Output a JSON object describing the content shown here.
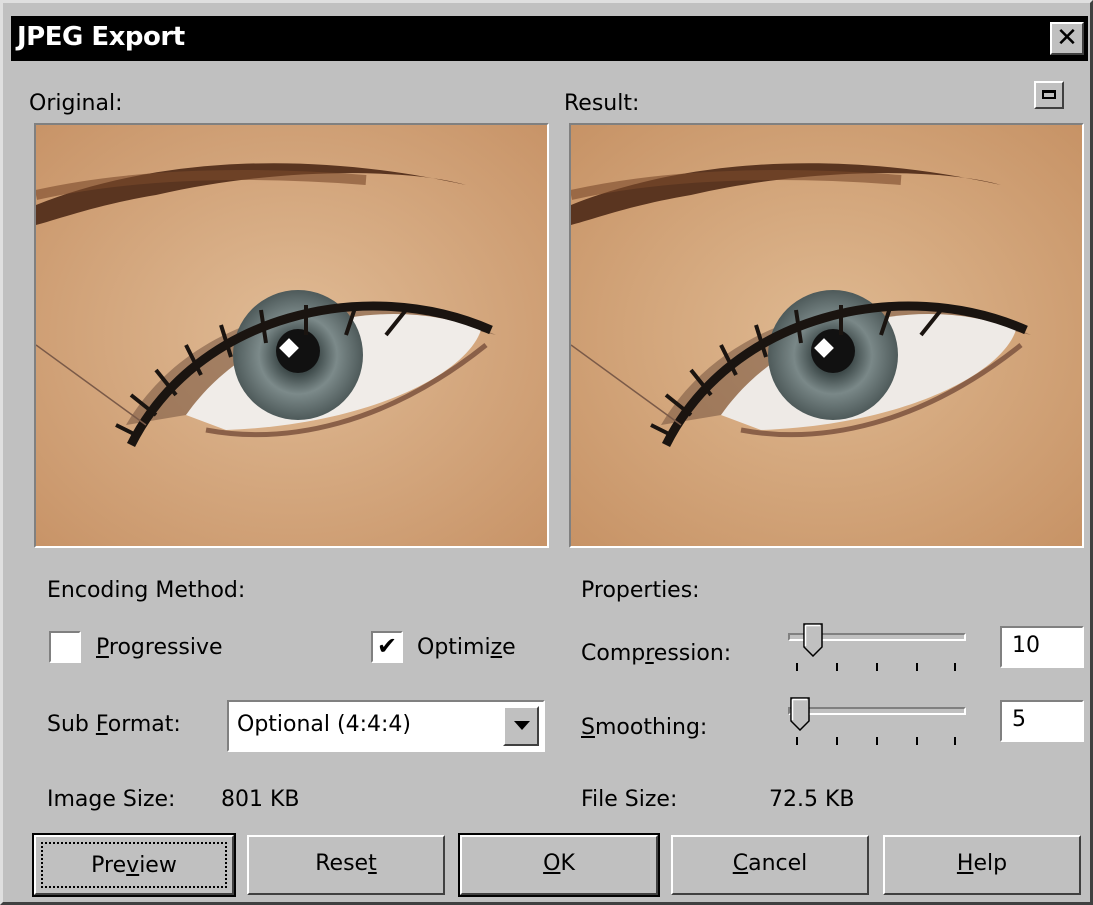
{
  "window": {
    "title": "JPEG Export",
    "close_glyph": "✕"
  },
  "panes": {
    "original_label": "Original:",
    "result_label": "Result:"
  },
  "encoding": {
    "heading": "Encoding Method:",
    "progressive_label_pre": "",
    "progressive_label_u": "P",
    "progressive_label_post": "rogressive",
    "progressive_checked": false,
    "optimize_label_pre": "Optimi",
    "optimize_label_u": "z",
    "optimize_label_post": "e",
    "optimize_checked": true,
    "check_glyph": "✔",
    "subformat_label_pre": "Sub ",
    "subformat_label_u": "F",
    "subformat_label_post": "ormat:",
    "subformat_value": "Optional (4:4:4)",
    "image_size_label": "Image Size:",
    "image_size_value": "801 KB"
  },
  "properties": {
    "heading": "Properties:",
    "compression_label_pre": "Comp",
    "compression_label_u": "r",
    "compression_label_post": "ession:",
    "compression_value": "10",
    "smoothing_label_pre": "",
    "smoothing_label_u": "S",
    "smoothing_label_post": "moothing:",
    "smoothing_value": "5",
    "file_size_label": "File Size:",
    "file_size_value": "72.5 KB"
  },
  "buttons": {
    "preview_pre": "Pre",
    "preview_u": "v",
    "preview_post": "iew",
    "reset_pre": "Rese",
    "reset_u": "t",
    "reset_post": "",
    "ok_pre": "",
    "ok_u": "O",
    "ok_post": "K",
    "cancel_pre": "",
    "cancel_u": "C",
    "cancel_post": "ancel",
    "help_pre": "",
    "help_u": "H",
    "help_post": "elp"
  },
  "icons": [
    "close-icon",
    "restore-icon",
    "check-icon",
    "dropdown-arrow-icon",
    "slider-thumb-icon"
  ]
}
